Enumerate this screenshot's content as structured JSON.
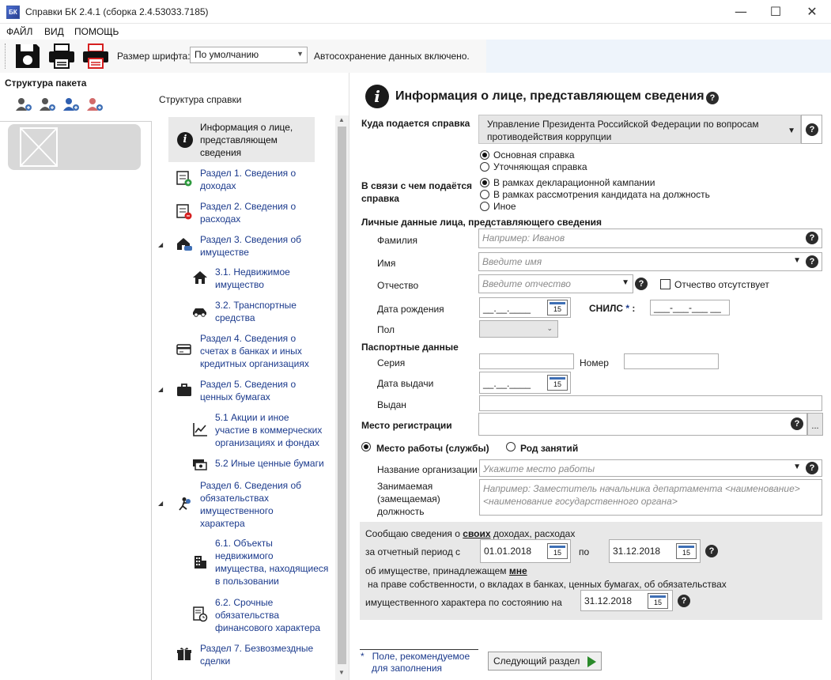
{
  "window": {
    "title": "Справки БК 2.4.1 (сборка 2.4.53033.7185)",
    "app_icon_text": "БК",
    "min": "—",
    "max": "☐",
    "close": "✕"
  },
  "menu": [
    "ФАЙЛ",
    "ВИД",
    "ПОМОЩЬ"
  ],
  "toolbar": {
    "font_size_label": "Размер шрифта:",
    "font_size_value": "По умолчанию",
    "autosave": "Автосохранение данных включено."
  },
  "left_panel": {
    "package_title": "Структура пакета",
    "structure_title": "Структура справки"
  },
  "tree": [
    {
      "label": "Информация о лице, представляющем сведения",
      "lines": [
        "Информация о лице,",
        "представляющем",
        "сведения"
      ]
    },
    {
      "lines": [
        "Раздел 1. Сведения о",
        "доходах"
      ]
    },
    {
      "lines": [
        "Раздел 2. Сведения о",
        "расходах"
      ]
    },
    {
      "lines": [
        "Раздел 3. Сведения об",
        "имуществе"
      ]
    },
    {
      "lines": [
        "3.1. Недвижимое",
        "имущество"
      ]
    },
    {
      "lines": [
        "3.2. Транспортные",
        "средства"
      ]
    },
    {
      "lines": [
        "Раздел 4. Сведения о",
        "счетах в банках и иных",
        "кредитных организациях"
      ]
    },
    {
      "lines": [
        "Раздел 5. Сведения о",
        "ценных бумагах"
      ]
    },
    {
      "lines": [
        "5.1 Акции и иное",
        "участие в коммерческих",
        "организациях и фондах"
      ]
    },
    {
      "lines": [
        "5.2 Иные ценные бумаги"
      ]
    },
    {
      "lines": [
        "Раздел 6. Сведения об",
        "обязательствах",
        "имущественного",
        "характера"
      ]
    },
    {
      "lines": [
        "6.1. Объекты",
        "недвижимого",
        "имущества, находящиеся",
        "в пользовании"
      ]
    },
    {
      "lines": [
        "6.2. Срочные",
        "обязательства",
        "финансового характера"
      ]
    },
    {
      "lines": [
        "Раздел 7. Безвозмездные",
        "сделки"
      ]
    }
  ],
  "form": {
    "title": "Информация о лице, представляющем сведения",
    "dest_label": "Куда подается справка",
    "dest_value_lines": [
      "Управление Президента Российской Федерации по вопросам",
      "противодействия коррупции"
    ],
    "type_options": [
      "Основная справка",
      "Уточняющая справка"
    ],
    "reason_label_lines": [
      "В связи с чем подаётся",
      "справка"
    ],
    "reason_options": [
      "В рамках декларационной кампании",
      "В рамках рассмотрения кандидата на должность",
      "Иное"
    ],
    "personal_heading": "Личные данные лица, представляющего сведения",
    "surname_label": "Фамилия",
    "surname_placeholder": "Например:  Иванов",
    "name_label": "Имя",
    "name_placeholder": "Введите имя",
    "patronymic_label": "Отчество",
    "patronymic_placeholder": "Введите отчество",
    "no_patronymic": "Отчество отсутствует",
    "birth_label": "Дата рождения",
    "date_mask": "__.__.____",
    "snils_label": "СНИЛС",
    "snils_star": "*",
    "snils_colon": ":",
    "snils_mask": "___-___-___ __",
    "gender_label": "Пол",
    "passport_heading": "Паспортные данные",
    "series_label": "Серия",
    "number_label": "Номер",
    "issue_date_label": "Дата выдачи",
    "issued_by_label": "Выдан",
    "registration_label": "Место регистрации",
    "ellipsis": "...",
    "work_option": "Место работы (службы)",
    "occupation_option": "Род занятий",
    "org_label": "Название организации",
    "org_placeholder": "Укажите место работы",
    "position_label_lines": [
      "Занимаемая",
      "(замещаемая)",
      "должность"
    ],
    "position_placeholder_lines": [
      "Например:  Заместитель начальника департамента <наименование>",
      "<наименование государственного органа>"
    ],
    "calendar_day": "15",
    "help": "?"
  },
  "period": {
    "line1_prefix": "Сообщаю сведения о ",
    "line1_bold": "своих",
    "line1_suffix": " доходах, расходах",
    "line2": "за отчетный период с",
    "from": "01.01.2018",
    "to_word": "по",
    "to": "31.12.2018",
    "line3_prefix": "об имуществе, принадлежащем ",
    "line3_bold": "мне",
    "line4": "на праве собственности, о вкладах в банках, ценных бумагах, об обязательствах",
    "line5": "имущественного характера по состоянию на",
    "as_of": "31.12.2018"
  },
  "footer": {
    "star": "*",
    "note_lines": [
      "Поле, рекомендуемое",
      "для заполнения"
    ],
    "next_button": "Следующий раздел"
  }
}
